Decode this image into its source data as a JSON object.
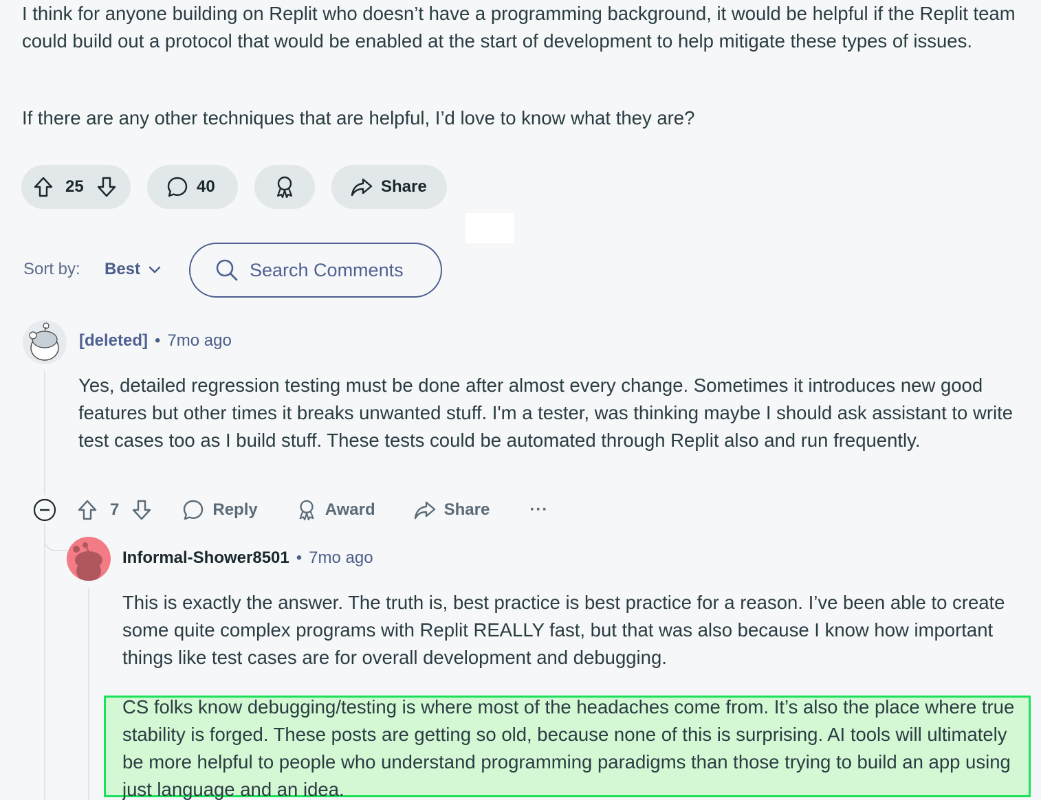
{
  "post": {
    "paragraph1": "I think for anyone building on Replit who doesn’t have a programming background, it would be helpful if the Replit team could build out a protocol that would be enabled at the start of development to help mitigate these types of issues.",
    "paragraph2": "If there are any other techniques that are helpful, I’d love to know what they are?",
    "actions": {
      "vote_count": "25",
      "comment_count": "40",
      "share_label": "Share"
    }
  },
  "sort": {
    "label": "Sort by:",
    "value": "Best"
  },
  "search": {
    "placeholder": "Search Comments"
  },
  "comments": [
    {
      "author": "[deleted]",
      "time": "7mo ago",
      "text": "Yes, detailed regression testing must be done after almost every change. Sometimes it introduces new good features but other times it breaks unwanted stuff. I'm a tester, was thinking maybe I should ask assistant to write test cases too as I build stuff. These tests could be automated through Replit also and run frequently.",
      "actions": {
        "vote_count": "7",
        "reply_label": "Reply",
        "award_label": "Award",
        "share_label": "Share",
        "more_label": "···"
      }
    },
    {
      "author": "Informal-Shower8501",
      "time": "7mo ago",
      "text_p1": "This is exactly the answer. The truth is, best practice is best practice for a reason. I’ve been able to create some quite complex programs with Replit REALLY fast, but that was also because I know how important things like test cases are for overall development and debugging.",
      "text_p2": "CS folks know debugging/testing is where most of the headaches come from. It’s also the place where true stability is forged. These posts are getting so old, because none of this is surprising. AI tools will ultimately be more helpful to people who understand programming paradigms than those trying to build an app using just language and an idea."
    }
  ],
  "colors": {
    "highlight_border": "#19e25a",
    "highlight_fill": "#d5f8d4",
    "pill_bg": "#e2e7e9",
    "link_blue": "#4f6192"
  }
}
